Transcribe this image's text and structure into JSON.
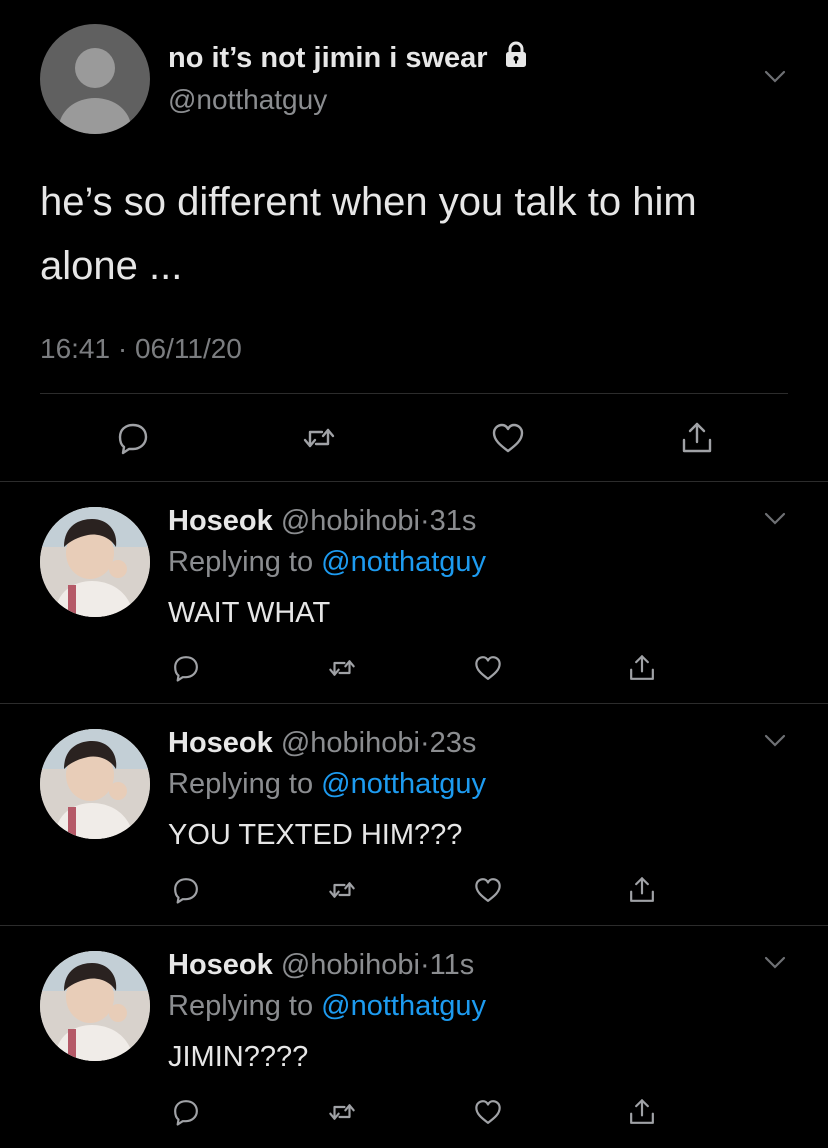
{
  "main_tweet": {
    "display_name": "no it’s not jimin i swear",
    "handle": "@notthatguy",
    "text": "he’s so different when you talk to him alone ...",
    "time": "16:41",
    "dot": "·",
    "date": "06/11/20",
    "icons": [
      "lock-icon",
      "chevron-down-icon",
      "reply-icon",
      "retweet-icon",
      "like-icon",
      "share-icon"
    ]
  },
  "replies": [
    {
      "name": "Hoseok",
      "handle": "@hobihobi",
      "dot": "·",
      "age": "31s",
      "replying_prefix": "Replying to",
      "replying_to": "@notthatguy",
      "text": "WAIT WHAT"
    },
    {
      "name": "Hoseok",
      "handle": "@hobihobi",
      "dot": "·",
      "age": "23s",
      "replying_prefix": "Replying to",
      "replying_to": "@notthatguy",
      "text": "YOU TEXTED HIM???"
    },
    {
      "name": "Hoseok",
      "handle": "@hobihobi",
      "dot": "·",
      "age": "11s",
      "replying_prefix": "Replying to",
      "replying_to": "@notthatguy",
      "text": "JIMIN????"
    }
  ],
  "colors": {
    "background": "#000000",
    "link": "#1d9bf0",
    "secondary_text": "#8b8d90",
    "divider": "#2c2c2c"
  }
}
